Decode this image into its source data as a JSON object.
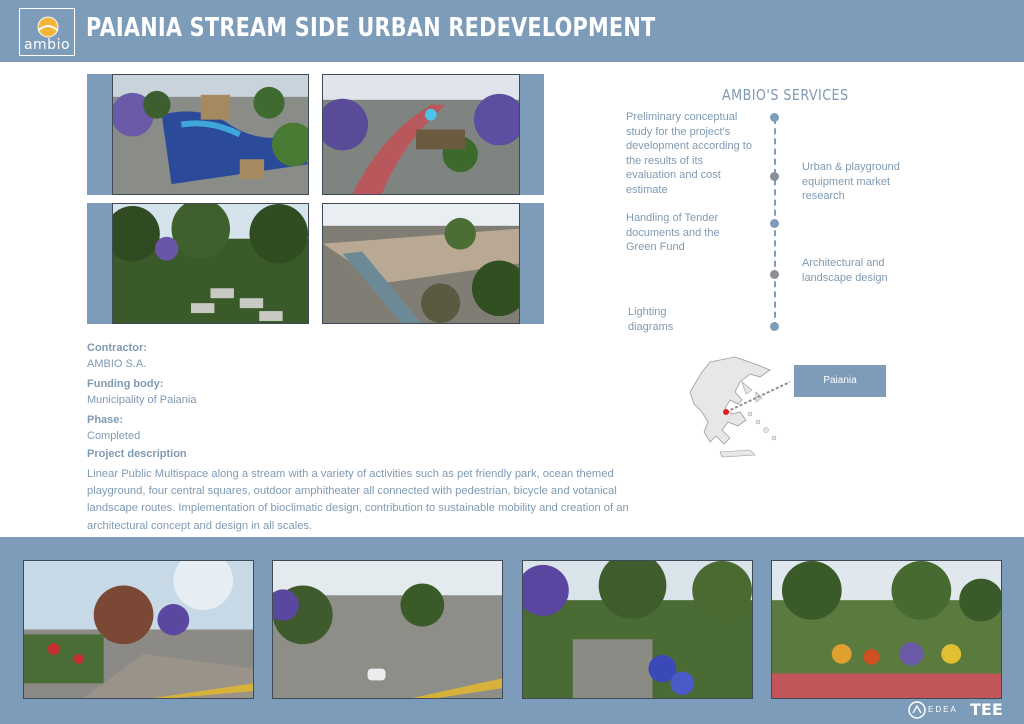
{
  "header": {
    "logo_text": "ambio",
    "title": "PAIANIA STREAM SIDE URBAN REDEVELOPMENT"
  },
  "services": {
    "title": "AMBIO'S SERVICES",
    "items": [
      {
        "text": "Preliminary conceptual study for the project's development according to the results of its evaluation and cost estimate",
        "side": "left"
      },
      {
        "text": "Urban & playground equipment market research",
        "side": "right"
      },
      {
        "text": "Handling of Tender documents and the Green Fund",
        "side": "left"
      },
      {
        "text": "Architectural and landscape design",
        "side": "right"
      },
      {
        "text": "Lighting diagrams",
        "side": "left"
      }
    ]
  },
  "info": {
    "contractor_label": "Contractor:",
    "contractor_value": "AMBIO S.A.",
    "funding_label": "Funding body:",
    "funding_value": "Municipality of Paiania",
    "phase_label": "Phase:",
    "phase_value": "Completed",
    "description_label": "Project description",
    "description": "Linear Public Multispace along a stream with a variety of activities such as pet friendly park, ocean themed playground, four central squares, outdoor amphitheater all connected with pedestrian, bicycle and votanical landscape routes. Implementation of bioclimatic design, contribution to sustainable mobility and creation of an architectural concept and design in all scales."
  },
  "map": {
    "location_label": "Paiania"
  },
  "footer": {
    "logo_1": "EDEA",
    "logo_2": "TEE"
  },
  "colors": {
    "band": "#7d9cb9",
    "text": "#7f9ab3",
    "marker": "#e02020"
  }
}
